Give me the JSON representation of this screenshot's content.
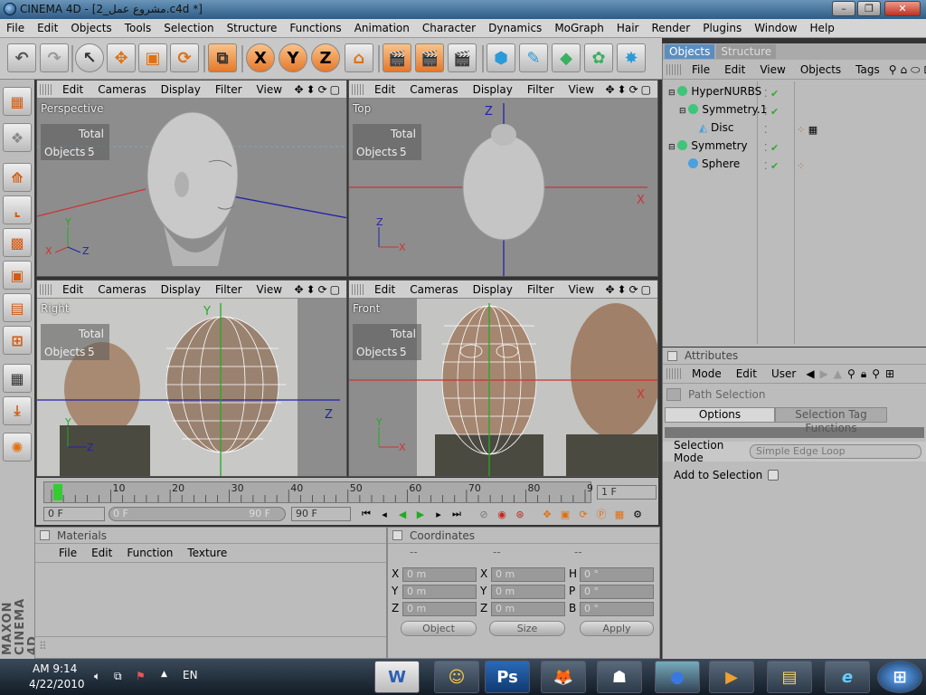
{
  "window": {
    "title": "CINEMA 4D - [مشروع عمل_2.c4d *]",
    "min": "–",
    "max": "❐",
    "close": "✕"
  },
  "menu": [
    "File",
    "Edit",
    "Objects",
    "Tools",
    "Selection",
    "Structure",
    "Functions",
    "Animation",
    "Character",
    "Dynamics",
    "MoGraph",
    "Hair",
    "Render",
    "Plugins",
    "Window",
    "Help"
  ],
  "toolbar": {
    "undo": "↶",
    "redo": "↷",
    "select": "↖",
    "move": "✥",
    "scale": "▣",
    "rotate": "⟳",
    "axis_x": "X",
    "axis_y": "Y",
    "axis_z": "Z",
    "coord": "⌂",
    "render1": "🎬",
    "render2": "🎬",
    "render3": "🎬",
    "cube": "⬢",
    "pen": "✎",
    "nurbs": "◆",
    "array": "✿",
    "deform": "✸"
  },
  "viewport_menu": [
    "Edit",
    "Cameras",
    "Display",
    "Filter",
    "View"
  ],
  "viewports": [
    {
      "name": "Perspective",
      "hud_total": "Total",
      "hud_label": "Objects",
      "hud_value": "5"
    },
    {
      "name": "Top",
      "hud_total": "Total",
      "hud_label": "Objects",
      "hud_value": "5"
    },
    {
      "name": "Right",
      "hud_total": "Total",
      "hud_label": "Objects",
      "hud_value": "5"
    },
    {
      "name": "Front",
      "hud_total": "Total",
      "hud_label": "Objects",
      "hud_value": "5"
    }
  ],
  "timeline": {
    "ticks": [
      "0",
      "10",
      "20",
      "30",
      "40",
      "50",
      "60",
      "70",
      "80",
      "90"
    ],
    "current_frame": "1 F",
    "start": "0 F",
    "range_start": "0 F",
    "range_end": "90 F",
    "end": "90 F",
    "playhead_frame": 1
  },
  "materials": {
    "title": "Materials",
    "menu": [
      "File",
      "Edit",
      "Function",
      "Texture"
    ]
  },
  "coordinates": {
    "title": "Coordinates",
    "col_headers": [
      "--",
      "--",
      "--"
    ],
    "rows": [
      {
        "a": "X",
        "av": "0 m",
        "b": "X",
        "bv": "0 m",
        "c": "H",
        "cv": "0 °"
      },
      {
        "a": "Y",
        "av": "0 m",
        "b": "Y",
        "bv": "0 m",
        "c": "P",
        "cv": "0 °"
      },
      {
        "a": "Z",
        "av": "0 m",
        "b": "Z",
        "bv": "0 m",
        "c": "B",
        "cv": "0 °"
      }
    ],
    "mode_select": "Object",
    "size_select": "Size",
    "apply": "Apply"
  },
  "objects_panel": {
    "tabs": [
      "Objects",
      "Structure"
    ],
    "menu": [
      "File",
      "Edit",
      "View",
      "Objects",
      "Tags"
    ],
    "items": [
      {
        "name": "HyperNURBS",
        "color": "#3fc47a"
      },
      {
        "name": "Symmetry.1",
        "color": "#3fc47a"
      },
      {
        "name": "Disc",
        "color": "#4aa0e0"
      },
      {
        "name": "Symmetry",
        "color": "#3fc47a"
      },
      {
        "name": "Sphere",
        "color": "#4aa0e0"
      }
    ]
  },
  "attributes": {
    "title": "Attributes",
    "menu": [
      "Mode",
      "Edit",
      "User"
    ],
    "object": "Path Selection",
    "tabs": [
      "Options",
      "Selection Tag Functions"
    ],
    "selection_mode_label": "Selection Mode",
    "selection_mode_value": "Simple Edge Loop",
    "add_label": "Add to Selection"
  },
  "taskbar": {
    "time": "AM 9:14",
    "date": "4/22/2010",
    "lang": "EN",
    "apps": [
      {
        "label": "W",
        "color": "#2b5fb4"
      },
      {
        "label": "☺",
        "color": "#3a7bd5"
      },
      {
        "label": "Ps",
        "color": "#1e5fa8"
      },
      {
        "label": "🦊",
        "color": "#d0621c"
      },
      {
        "label": "☗",
        "color": "#ddd"
      },
      {
        "label": "●",
        "color": "#1d4fa8"
      },
      {
        "label": "▶",
        "color": "#e08a20"
      },
      {
        "label": "▤",
        "color": "#e8c060"
      },
      {
        "label": "e",
        "color": "#2e86d6"
      },
      {
        "label": "⊞",
        "color": "#3c8de0"
      }
    ]
  }
}
